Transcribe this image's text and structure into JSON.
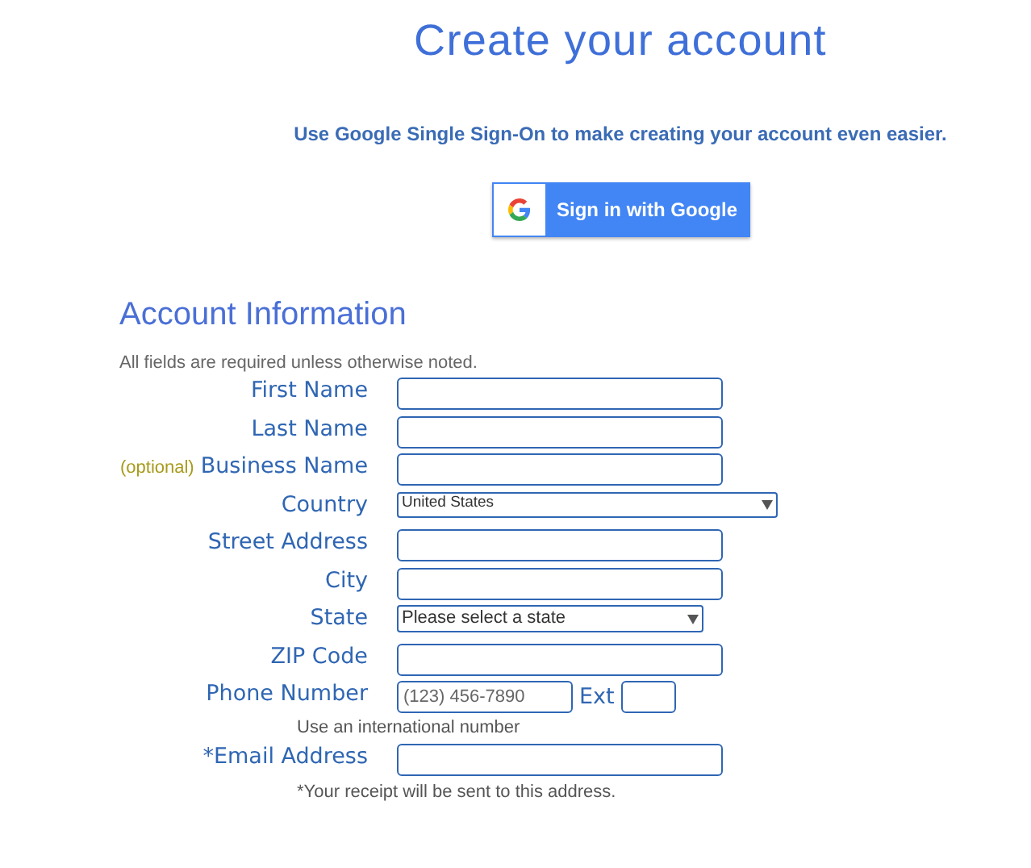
{
  "title": "Create your account",
  "sso": {
    "prompt": "Use Google Single Sign-On to make creating your account even easier.",
    "button": "Sign in with Google"
  },
  "section": {
    "heading": "Account Information",
    "note": "All fields are required unless otherwise noted."
  },
  "fields": [
    {
      "kind": "text",
      "label": "First Name"
    },
    {
      "kind": "text",
      "label": "Last Name"
    },
    {
      "kind": "text",
      "label": "Business Name",
      "optional": "(optional)"
    },
    {
      "kind": "select",
      "label": "Country",
      "value": "United States"
    },
    {
      "kind": "text",
      "label": "Street Address"
    },
    {
      "kind": "text",
      "label": "City"
    },
    {
      "kind": "shortselect",
      "label": "State",
      "value": "Please select a state"
    },
    {
      "kind": "text",
      "label": "ZIP Code"
    },
    {
      "kind": "phone",
      "label": "Phone Number",
      "placeholder": "(123) 456-7890",
      "ext_label": "Ext",
      "hint": "Use an international number"
    },
    {
      "kind": "text",
      "label": "*Email Address",
      "hint": "*Your receipt will be sent to this address."
    }
  ]
}
